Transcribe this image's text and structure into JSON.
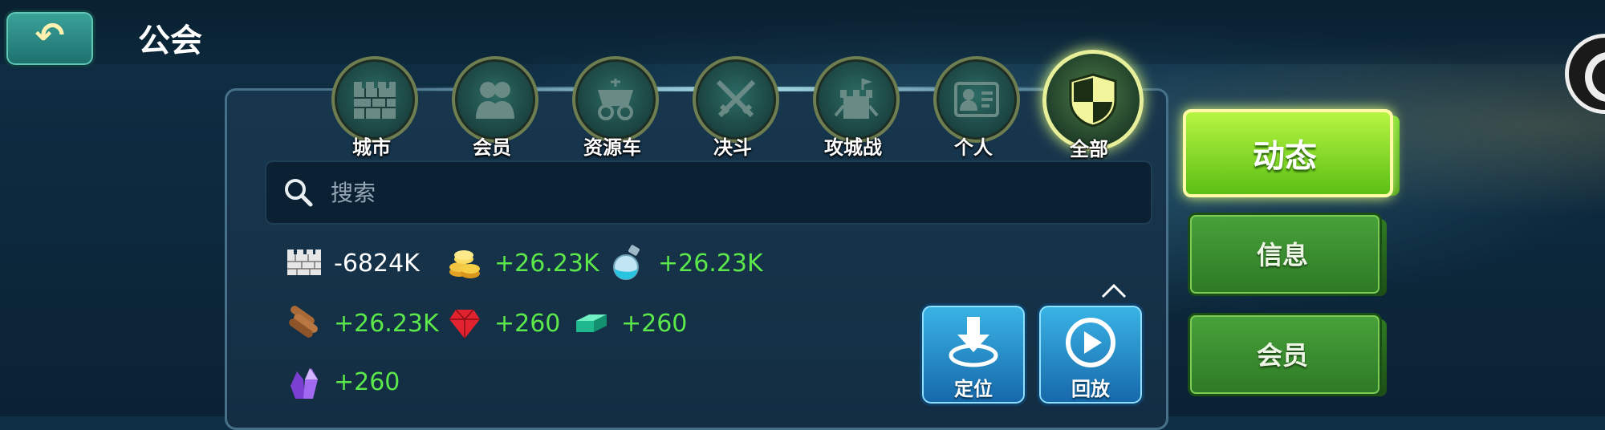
{
  "header": {
    "title": "公会"
  },
  "category_tabs": [
    {
      "label": "城市",
      "icon": "castle-wall-icon"
    },
    {
      "label": "会员",
      "icon": "members-icon"
    },
    {
      "label": "资源车",
      "icon": "resource-cart-icon"
    },
    {
      "label": "决斗",
      "icon": "crossed-swords-icon"
    },
    {
      "label": "攻城战",
      "icon": "siege-icon"
    },
    {
      "label": "个人",
      "icon": "personal-card-icon"
    },
    {
      "label": "全部",
      "icon": "shield-checker-icon",
      "active": true
    }
  ],
  "search": {
    "placeholder": "搜索",
    "value": ""
  },
  "resources": [
    {
      "icon": "wall-icon",
      "value": "-6824K"
    },
    {
      "icon": "gold-coins-icon",
      "value": "+26.23K"
    },
    {
      "icon": "potion-icon",
      "value": "+26.23K"
    },
    {
      "icon": "wood-logs-icon",
      "value": "+26.23K"
    },
    {
      "icon": "ruby-icon",
      "value": "+260"
    },
    {
      "icon": "jade-bar-icon",
      "value": "+260"
    },
    {
      "icon": "crystal-icon",
      "value": "+260"
    }
  ],
  "actions": {
    "locate_label": "定位",
    "replay_label": "回放"
  },
  "side_tabs": [
    {
      "label": "动态",
      "active": true
    },
    {
      "label": "信息"
    },
    {
      "label": "会员"
    }
  ],
  "colors": {
    "gain": "#5ce84a",
    "loss": "#ffffff",
    "active_tab": "#b7f542",
    "side_tab": "#48a23a",
    "action_button": "#2a8fcf"
  }
}
